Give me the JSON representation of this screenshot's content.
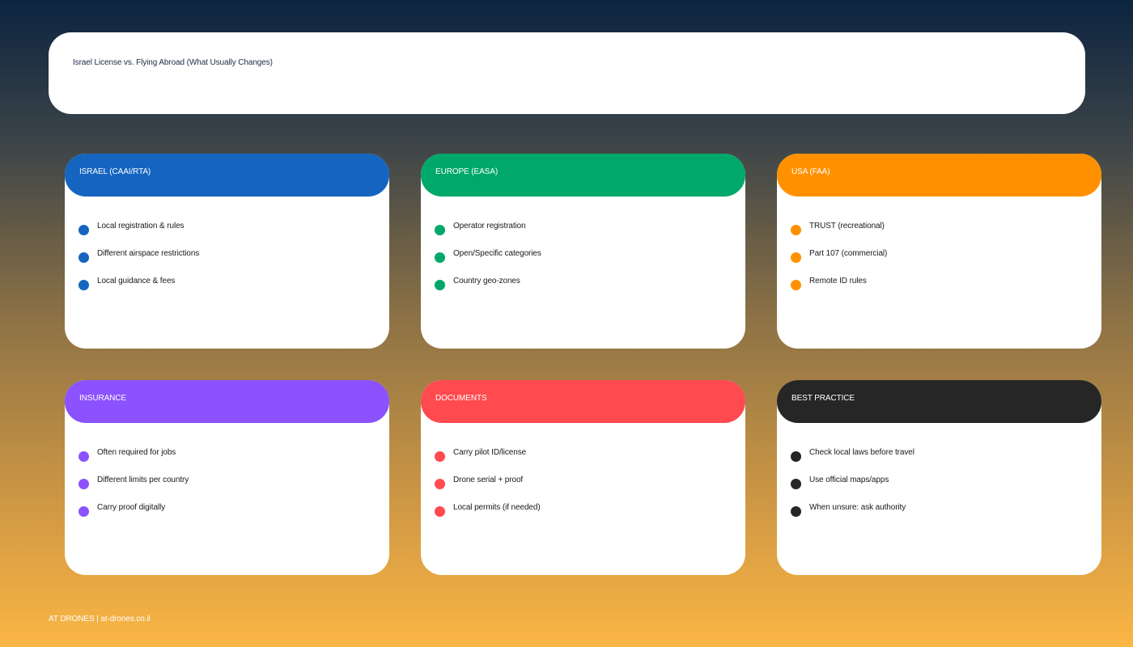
{
  "title": "Israel License vs. Flying Abroad (What Usually Changes)",
  "cards": [
    {
      "header": "ISRAEL (CAAI/RTA)",
      "color": "#1565c0",
      "items": [
        "Local registration & rules",
        "Different airspace restrictions",
        "Local guidance & fees"
      ]
    },
    {
      "header": "EUROPE (EASA)",
      "color": "#00a86b",
      "items": [
        "Operator registration",
        "Open/Specific categories",
        "Country geo-zones"
      ]
    },
    {
      "header": "USA (FAA)",
      "color": "#ff9100",
      "items": [
        "TRUST (recreational)",
        "Part 107 (commercial)",
        "Remote ID rules"
      ]
    },
    {
      "header": "INSURANCE",
      "color": "#8c52ff",
      "items": [
        "Often required for jobs",
        "Different limits per country",
        "Carry proof digitally"
      ]
    },
    {
      "header": "DOCUMENTS",
      "color": "#ff4a4f",
      "items": [
        "Carry pilot ID/license",
        "Drone serial + proof",
        "Local permits (if needed)"
      ]
    },
    {
      "header": "BEST PRACTICE",
      "color": "#262626",
      "items": [
        "Check local laws before travel",
        "Use official maps/apps",
        "When unsure: ask authority"
      ]
    }
  ],
  "footer": "AT DRONES | at-drones.co.il"
}
